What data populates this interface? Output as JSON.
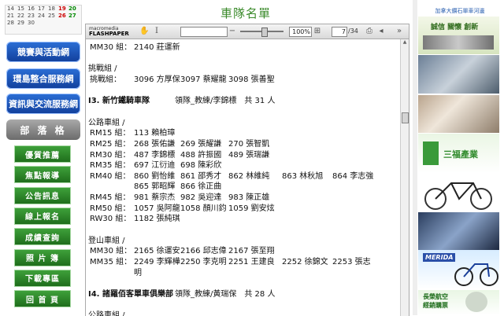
{
  "calendar": {
    "rows": [
      [
        "14",
        "15",
        "16",
        "17",
        "18",
        "19",
        "20"
      ],
      [
        "21",
        "22",
        "23",
        "24",
        "25",
        "26",
        "27"
      ],
      [
        "28",
        "29",
        "30",
        "",
        "",
        "",
        ""
      ]
    ]
  },
  "nav": {
    "blue_buttons": [
      "競賽與活動網",
      "環島整合服務網",
      "資訊與交流服務網"
    ],
    "grey_button": "部 落 格",
    "green_buttons": [
      "優質推薦",
      "焦點報導",
      "公告訊息",
      "線上報名",
      "成績查詢",
      "照 片 簿",
      "下載專區",
      "回 首 頁"
    ]
  },
  "page_title": "車隊名單",
  "viewer": {
    "logo_line1": "macromedia",
    "logo_line2": "FLASHPAPER",
    "zoom": "100%",
    "page_current": "7",
    "page_total": "/34",
    "zoom_level": 0.55
  },
  "doc": {
    "lines": [
      {
        "label": "MM30 組：",
        "entries": [
          "2140 莊運新"
        ]
      },
      {
        "label": "",
        "entries": []
      },
      {
        "label": "挑戰組 /",
        "entries": [],
        "plain": true
      },
      {
        "label": "挑戰組：",
        "entries": [
          "3096 方厚保",
          "3097 蔡耀龍",
          "3098 張善聖"
        ]
      },
      {
        "label": "",
        "entries": []
      },
      {
        "heading": "I3. 新竹鐵騎車隊",
        "rest": "領隊_教練/李錦標　共 31 人"
      },
      {
        "label": "",
        "entries": []
      },
      {
        "label": "公路車組 /",
        "entries": [],
        "plain": true
      },
      {
        "label": "RM15 組：",
        "entries": [
          "113 賴柏璋"
        ]
      },
      {
        "label": "RM25 組：",
        "entries": [
          "268 張佑謙",
          "269 張耀謙",
          "270 張智凱"
        ]
      },
      {
        "label": "RM30 組：",
        "entries": [
          "487 李錦標",
          "488 許振國",
          "489 張瑞謙"
        ]
      },
      {
        "label": "RM35 組：",
        "entries": [
          "697 江衍迪",
          "698 陳彩欣"
        ]
      },
      {
        "label": "RM40 組：",
        "entries": [
          "860 劉怡維",
          "861 邵秀才",
          "862 林維純",
          "863 林秋旭",
          "864 李志強"
        ]
      },
      {
        "label": "",
        "entries": [
          "865 郭昭輝",
          "866 徐正曲"
        ],
        "indent": true
      },
      {
        "label": "RM45 組：",
        "entries": [
          "981 蔡宗杰",
          "982 吳迎達",
          "983 陳正雄"
        ]
      },
      {
        "label": "RM50 組：",
        "entries": [
          "1057 吳阿龍",
          "1058 顏川鈞",
          "1059 劉安炫"
        ]
      },
      {
        "label": "RW30 組：",
        "entries": [
          "1182 張純琪"
        ]
      },
      {
        "label": "",
        "entries": []
      },
      {
        "label": "登山車組 /",
        "entries": [],
        "plain": true
      },
      {
        "label": "MM30 組：",
        "entries": [
          "2165 徐運安",
          "2166 邱志偉",
          "2167 張至翔"
        ]
      },
      {
        "label": "MM35 組：",
        "entries": [
          "2249 李輝樺",
          "2250 李克明",
          "2251 王建良",
          "2252 徐錦文",
          "2253 張志"
        ]
      },
      {
        "label": "",
        "entries": [
          "明"
        ],
        "indent": true
      },
      {
        "label": "",
        "entries": []
      },
      {
        "heading": "I4. 諸羅佰客單車俱樂部",
        "rest": "領隊_教練/黃瑞保　共 28 人"
      },
      {
        "label": "",
        "entries": []
      },
      {
        "label": "公路車組 /",
        "entries": [],
        "plain": true
      }
    ]
  },
  "ads": {
    "top_link": "加拿大鑽石單車河邊",
    "slogan": "誠信 關懷 創新",
    "brand1": "三福產業",
    "brand2": "MERIDA",
    "brand3": "長榮航空",
    "brand3_sub": "經銷購票",
    "colors": {
      "blue": "#1f4fb5",
      "green": "#2f8a2b",
      "title": "#3a8a2a"
    }
  }
}
